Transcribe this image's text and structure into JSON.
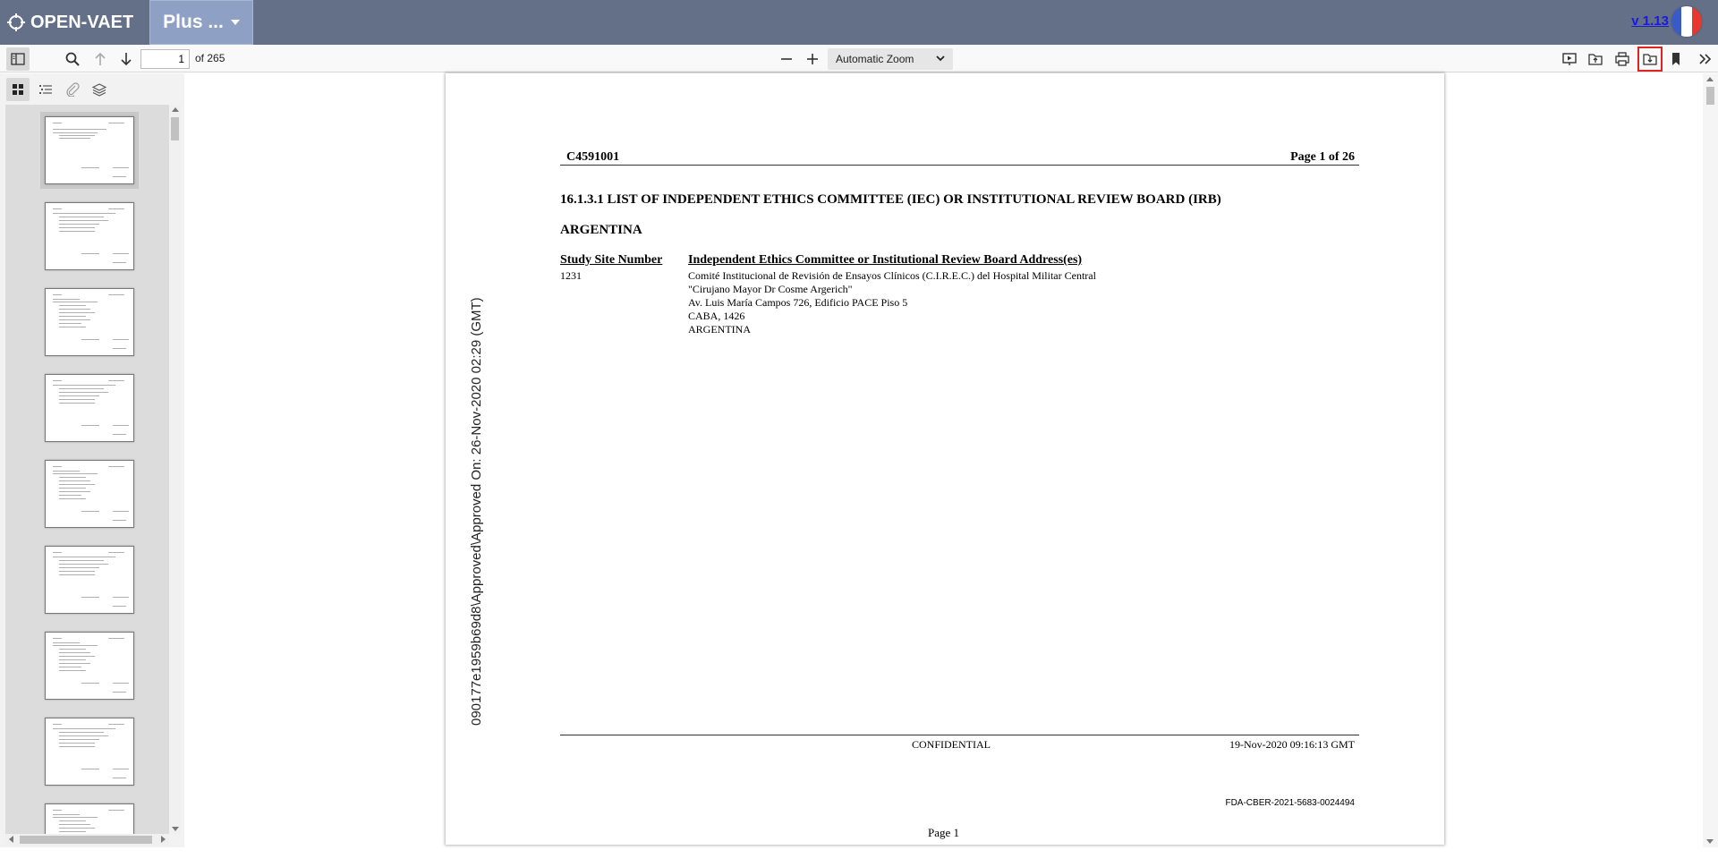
{
  "app": {
    "brand": "OPEN-VAET",
    "plus_menu": "Plus ...",
    "version": "v 1.13",
    "flag_colors": [
      "#3a5bc7",
      "#ffffff",
      "#e8372f"
    ]
  },
  "toolbar": {
    "page_number": "1",
    "page_count": "of 265",
    "zoom": "Automatic Zoom",
    "highlight_color": "#e02424"
  },
  "sidebar": {
    "thumbnail_count_visible": 9,
    "selected_thumbnail": 1
  },
  "document": {
    "doc_id": "C4591001",
    "page_of": "Page 1 of 26",
    "section_title": "16.1.3.1 LIST OF INDEPENDENT ETHICS COMMITTEE (IEC) OR INSTITUTIONAL REVIEW BOARD (IRB)",
    "country": "ARGENTINA",
    "col_site": "Study Site Number",
    "col_address": "Independent Ethics Committee or Institutional Review Board Address(es)",
    "site_number": "1231",
    "address_lines": [
      "Comité Institucional de Revisión de Ensayos Clínicos (C.I.R.E.C.) del Hospital Militar Central",
      "\"Cirujano Mayor Dr Cosme Argerich\"",
      "Av. Luis María Campos 726, Edificio PACE Piso 5",
      "CABA, 1426",
      "ARGENTINA"
    ],
    "watermark": "090177e1959b69d8\\Approved\\Approved On: 26-Nov-2020 02:29 (GMT)",
    "confidential": "CONFIDENTIAL",
    "footer_date": "19-Nov-2020 09:16:13 GMT",
    "fda_number": "FDA-CBER-2021-5683-0024494",
    "page_footer": "Page 1"
  }
}
